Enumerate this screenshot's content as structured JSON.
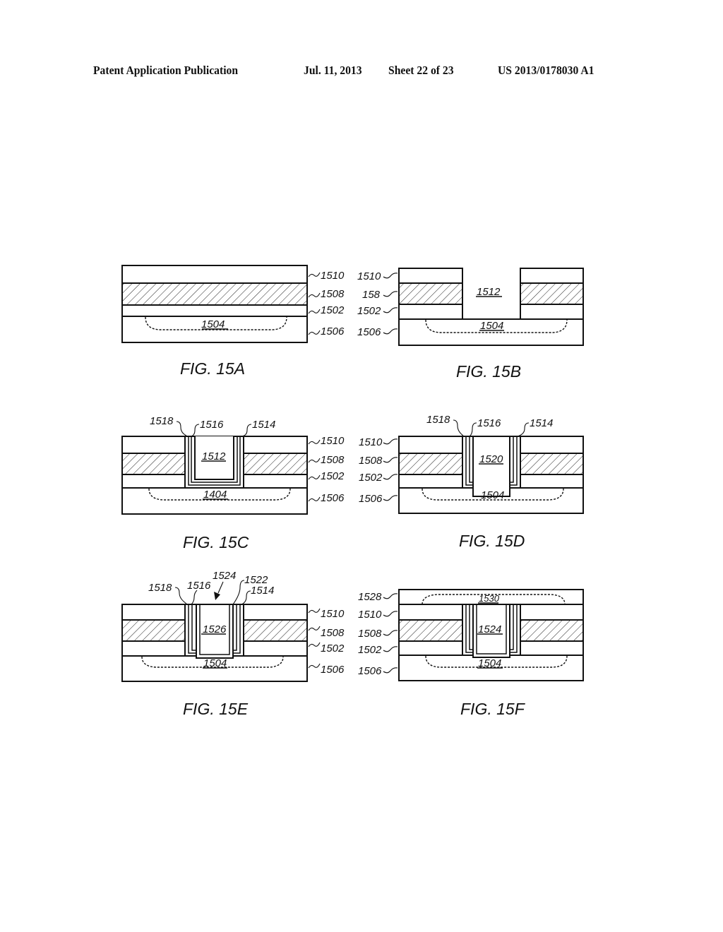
{
  "header": {
    "publication": "Patent Application Publication",
    "date": "Jul. 11, 2013",
    "sheet": "Sheet 22 of 23",
    "number": "US 2013/0178030 A1"
  },
  "figures": {
    "fig15a": {
      "caption": "FIG. 15A",
      "labels": {
        "l1510": "1510",
        "l1508": "1508",
        "l1502": "1502",
        "l1506": "1506",
        "r1504": "1504"
      }
    },
    "fig15b": {
      "caption": "FIG. 15B",
      "labels": {
        "l1510": "1510",
        "l1508": "158",
        "l1502": "1502",
        "l1506": "1506",
        "r1512": "1512",
        "r1504": "1504"
      }
    },
    "fig15c": {
      "caption": "FIG. 15C",
      "labels": {
        "l1518": "1518",
        "l1516": "1516",
        "l1514": "1514",
        "l1510": "1510",
        "l1508": "1508",
        "l1502": "1502",
        "l1506": "1506",
        "r1512": "1512",
        "r1504": "1404"
      }
    },
    "fig15d": {
      "caption": "FIG. 15D",
      "labels": {
        "l1518": "1518",
        "l1516": "1516",
        "l1514": "1514",
        "l1510": "1510",
        "l1508": "1508",
        "l1502": "1502",
        "l1506": "1506",
        "r1520": "1520",
        "r1504": "1504"
      }
    },
    "fig15e": {
      "caption": "FIG. 15E",
      "labels": {
        "l1518": "1518",
        "l1516": "1516",
        "l1524": "1524",
        "l1522": "1522",
        "l1514": "1514",
        "l1510": "1510",
        "l1508": "1508",
        "l1502": "1502",
        "l1506": "1506",
        "r1526": "1526",
        "r1504": "1504"
      }
    },
    "fig15f": {
      "caption": "FIG. 15F",
      "labels": {
        "l1528": "1528",
        "l1510": "1510",
        "l1508": "1508",
        "l1502": "1502",
        "l1506": "1506",
        "r1530": "1530",
        "r1524": "1524",
        "r1504": "1504"
      }
    }
  }
}
